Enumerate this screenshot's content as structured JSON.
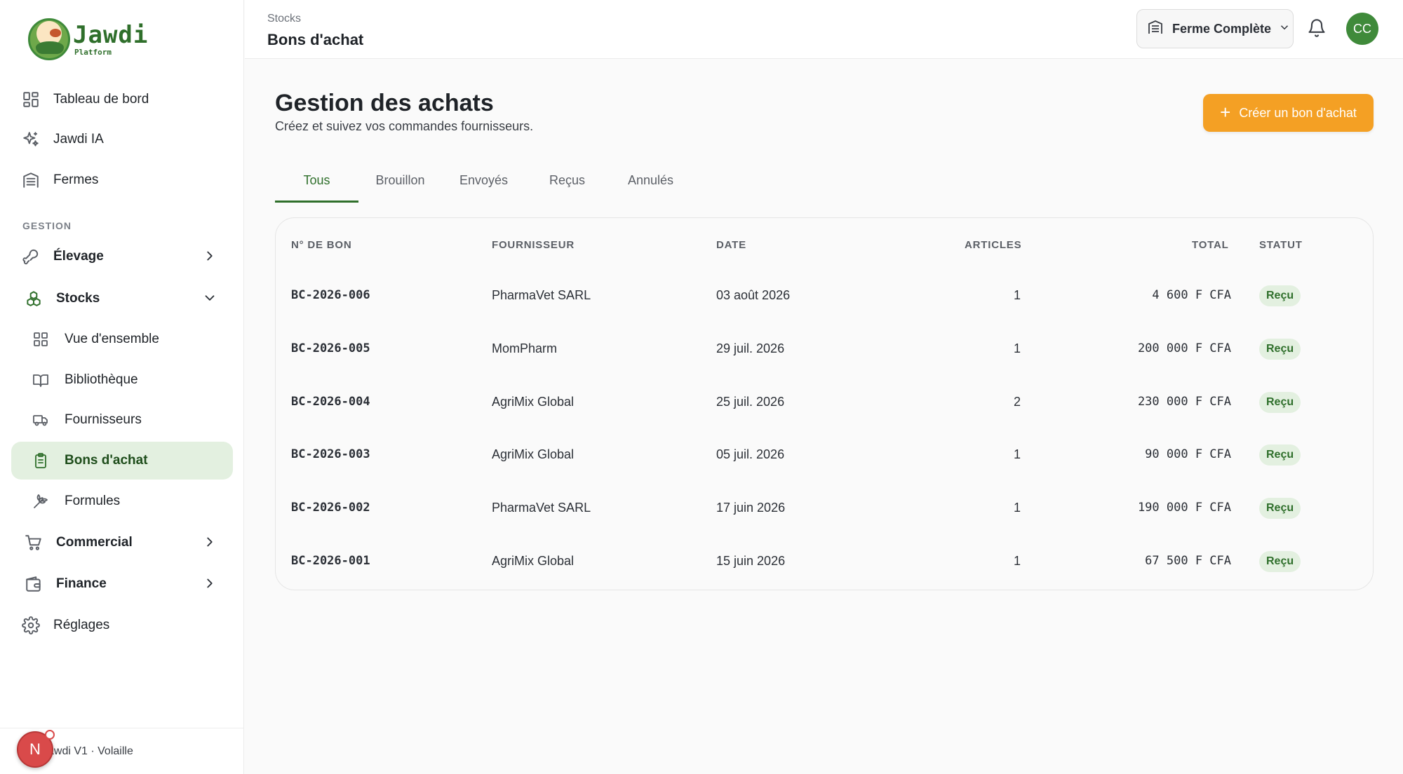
{
  "brand": {
    "name": "Jawdi",
    "sub": "Platform"
  },
  "sidebar": {
    "top_items": [
      {
        "label": "Tableau de bord",
        "icon": "dashboard-icon"
      },
      {
        "label": "Jawdi IA",
        "icon": "sparkles-icon"
      },
      {
        "label": "Fermes",
        "icon": "building-icon"
      }
    ],
    "section_label": "GESTION",
    "elevage": "Élevage",
    "stocks": "Stocks",
    "stocks_sub": [
      {
        "label": "Vue d'ensemble",
        "icon": "grid-icon"
      },
      {
        "label": "Bibliothèque",
        "icon": "book-icon"
      },
      {
        "label": "Fournisseurs",
        "icon": "truck-icon"
      },
      {
        "label": "Bons d'achat",
        "icon": "clipboard-icon",
        "active": true
      },
      {
        "label": "Formules",
        "icon": "wheat-icon"
      }
    ],
    "commercial": "Commercial",
    "finance": "Finance",
    "reglages": "Réglages",
    "footer_text": "Jawdi V1 · Volaille",
    "footer_avatar": "N"
  },
  "topbar": {
    "breadcrumb": "Stocks",
    "title": "Bons d'achat",
    "farm": "Ferme Complète",
    "avatar": "CC"
  },
  "main": {
    "title": "Gestion des achats",
    "subtitle": "Créez et suivez vos commandes fournisseurs.",
    "create_button": "Créer un bon d'achat",
    "tabs": [
      "Tous",
      "Brouillon",
      "Envoyés",
      "Reçus",
      "Annulés"
    ],
    "active_tab": "Tous",
    "columns": {
      "number": "N° DE BON",
      "supplier": "FOURNISSEUR",
      "date": "DATE",
      "articles": "ARTICLES",
      "total": "TOTAL",
      "status": "STATUT"
    },
    "rows": [
      {
        "number": "BC-2026-006",
        "supplier": "PharmaVet SARL",
        "date": "03 août 2026",
        "articles": "1",
        "total": "4 600 F CFA",
        "status": "Reçu"
      },
      {
        "number": "BC-2026-005",
        "supplier": "MomPharm",
        "date": "29 juil. 2026",
        "articles": "1",
        "total": "200 000 F CFA",
        "status": "Reçu"
      },
      {
        "number": "BC-2026-004",
        "supplier": "AgriMix Global",
        "date": "25 juil. 2026",
        "articles": "2",
        "total": "230 000 F CFA",
        "status": "Reçu"
      },
      {
        "number": "BC-2026-003",
        "supplier": "AgriMix Global",
        "date": "05 juil. 2026",
        "articles": "1",
        "total": "90 000 F CFA",
        "status": "Reçu"
      },
      {
        "number": "BC-2026-002",
        "supplier": "PharmaVet SARL",
        "date": "17 juin 2026",
        "articles": "1",
        "total": "190 000 F CFA",
        "status": "Reçu"
      },
      {
        "number": "BC-2026-001",
        "supplier": "AgriMix Global",
        "date": "15 juin 2026",
        "articles": "1",
        "total": "67 500 F CFA",
        "status": "Reçu"
      }
    ]
  },
  "colors": {
    "brand_green": "#2f6f2b",
    "accent_orange": "#f4a024",
    "active_bg": "#e3f0e0"
  }
}
